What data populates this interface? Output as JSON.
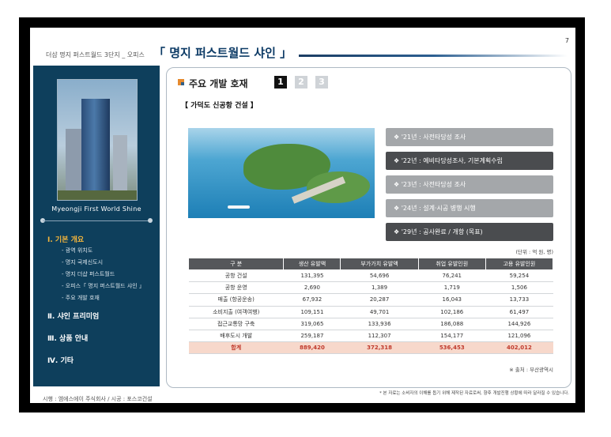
{
  "page_number": "7",
  "header": {
    "small": "더샵 명지 퍼스트월드 3단지 _ 오피스",
    "title": "「 명지 퍼스트월드 샤인 」"
  },
  "sidebar": {
    "brand": "Myeongji First World Shine",
    "menu": [
      {
        "label": "Ⅰ. 기본 개요",
        "active": true
      },
      {
        "label": "Ⅱ. 샤인 프리미엄"
      },
      {
        "label": "Ⅲ. 상품 안내"
      },
      {
        "label": "Ⅳ. 기타"
      }
    ],
    "submenu": [
      "- 광역 위치도",
      "- 명지 국제신도시",
      "- 명지 더샵 퍼스트월드",
      "- 오피스「 명지 퍼스트월드 샤인 」",
      "- 주요 개발 호재"
    ]
  },
  "footer": "시행 : 엠에스에이 주식회사   /   시공 : 포스코건설",
  "section": {
    "title": "주요 개발 호재",
    "pages": [
      "1",
      "2",
      "3"
    ],
    "subtitle": "【 가덕도 신공항 건설 】"
  },
  "timeline": [
    {
      "text": "❖  '21년 : 사전타당성 조사",
      "tone": "light"
    },
    {
      "text": "❖  '22년 : 예비타당성조사, 기본계획수립",
      "tone": "dark"
    },
    {
      "text": "❖  '23년 : 사전타당성 조사",
      "tone": "light"
    },
    {
      "text": "❖  '24년 : 설계·시공 병행 시행",
      "tone": "light"
    },
    {
      "text": "❖  '29년 : 공사완료 / 개항 (목표)",
      "tone": "dark"
    }
  ],
  "table": {
    "unit": "(단위 : 억 원, 명)",
    "headers": [
      "구    분",
      "생산 유발액",
      "부가가치 유발액",
      "취업 유발인원",
      "고용 유발인원"
    ],
    "rows": [
      [
        "공항 건설",
        "131,395",
        "54,696",
        "76,241",
        "59,254"
      ],
      [
        "공항 운영",
        "2,690",
        "1,389",
        "1,719",
        "1,506"
      ],
      [
        "매출 (항공운송)",
        "67,932",
        "20,287",
        "16,043",
        "13,733"
      ],
      [
        "소비지출 (여객여행)",
        "109,151",
        "49,701",
        "102,186",
        "61,497"
      ],
      [
        "접근교통망 구축",
        "319,065",
        "133,936",
        "186,088",
        "144,926"
      ],
      [
        "배후도시 개발",
        "259,187",
        "112,307",
        "154,177",
        "121,096"
      ]
    ],
    "total": [
      "합계",
      "889,420",
      "372,318",
      "536,453",
      "402,012"
    ],
    "source": "※ 출처 : 부산광역시"
  },
  "note": "* 본 자료는 소비자의 이해를 돕기 위해 제작된 자료로써, 향후 개발진행 상황에 따라 달라질 수 있습니다."
}
